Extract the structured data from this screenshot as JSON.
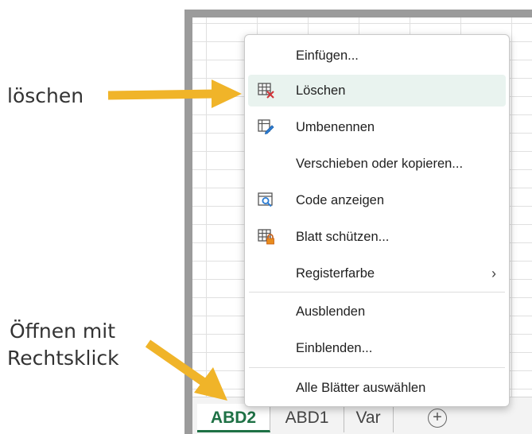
{
  "annotations": {
    "delete_note": "löschen",
    "open_note_line1": "Öffnen mit",
    "open_note_line2": "Rechtsklick"
  },
  "context_menu": {
    "items": [
      {
        "label": "Einfügen...",
        "icon": "none"
      },
      {
        "label": "Löschen",
        "icon": "delete-sheet-icon",
        "highlighted": true
      },
      {
        "label": "Umbenennen",
        "icon": "rename-sheet-icon"
      },
      {
        "label": "Verschieben oder kopieren...",
        "icon": "none"
      },
      {
        "label": "Code anzeigen",
        "icon": "view-code-icon"
      },
      {
        "label": "Blatt schützen...",
        "icon": "protect-sheet-icon"
      },
      {
        "label": "Registerfarbe",
        "icon": "none",
        "submenu": true
      },
      {
        "label": "Ausblenden",
        "icon": "none"
      },
      {
        "label": "Einblenden...",
        "icon": "none"
      },
      {
        "label": "Alle Blätter auswählen",
        "icon": "none"
      }
    ],
    "submenu_glyph": "›"
  },
  "sheet_tabs": [
    {
      "label": "ABD2",
      "active": true
    },
    {
      "label": "ABD1",
      "active": false
    },
    {
      "label": "Var",
      "active": false
    }
  ],
  "add_sheet_glyph": "+",
  "colors": {
    "arrow": "#f0b429",
    "excel_green": "#1e7145",
    "highlight": "#e9f3ef"
  }
}
